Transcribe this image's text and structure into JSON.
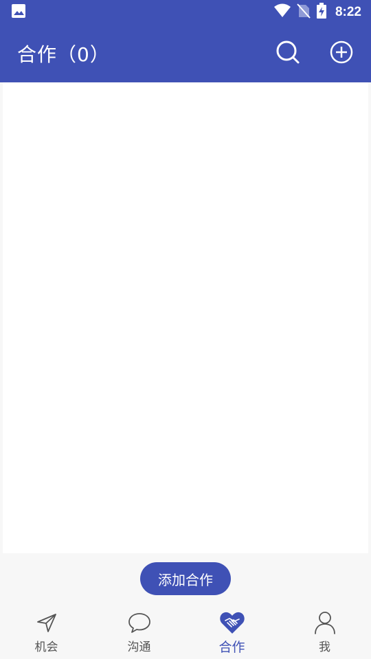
{
  "status_bar": {
    "time": "8:22",
    "icons": [
      "image-icon",
      "wifi-icon",
      "no-sim-icon",
      "battery-charging-icon"
    ]
  },
  "app_bar": {
    "title": "合作（0）",
    "actions": [
      "search-icon",
      "add-circle-icon"
    ]
  },
  "main": {
    "add_button_label": "添加合作"
  },
  "bottom_nav": {
    "items": [
      {
        "label": "机会",
        "icon": "send-icon"
      },
      {
        "label": "沟通",
        "icon": "chat-bubble-icon"
      },
      {
        "label": "合作",
        "icon": "handshake-heart-icon",
        "active": true
      },
      {
        "label": "我",
        "icon": "person-icon"
      }
    ]
  },
  "colors": {
    "primary": "#3f51b5",
    "background": "#f7f7f7",
    "inactive": "#555555"
  }
}
